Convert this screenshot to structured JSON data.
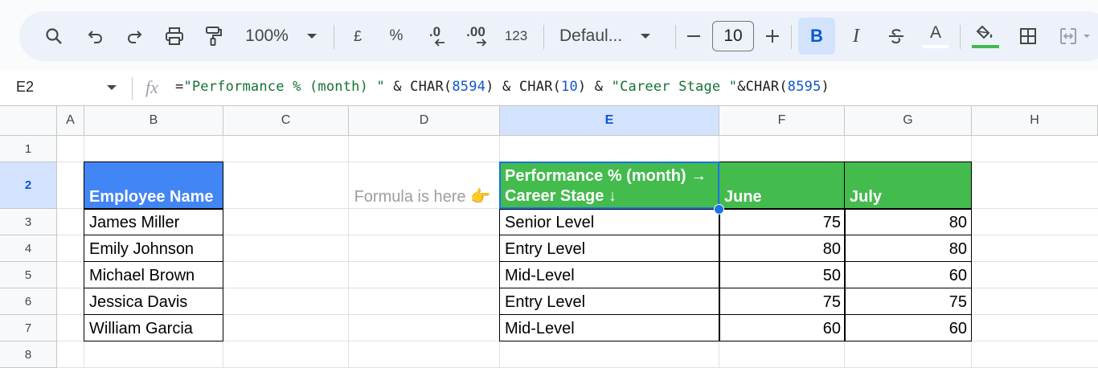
{
  "toolbar": {
    "zoom": "100%",
    "currency_label": "£",
    "percent_label": "%",
    "decrease_decimal_label": ".0",
    "increase_decimal_label": ".00",
    "more_formats_label": "123",
    "font_name": "Defaul...",
    "font_size": "10",
    "bold_label": "B",
    "italic_label": "I",
    "text_color_label": "A"
  },
  "formula_bar": {
    "name_box": "E2",
    "fx_label": "fx",
    "formula_parts": {
      "p1": "=",
      "p2": "\"Performance % (month) \"",
      "p3": " & CHAR(",
      "p4": "8594",
      "p5": ") & CHAR(",
      "p6": "10",
      "p7": ") & ",
      "p8": "\"Career Stage \"",
      "p9": "&CHAR(",
      "p10": "8595",
      "p11": ")"
    }
  },
  "columns": [
    "A",
    "B",
    "C",
    "D",
    "E",
    "F",
    "G",
    "H"
  ],
  "rows": [
    "1",
    "2",
    "3",
    "4",
    "5",
    "6",
    "7",
    "8"
  ],
  "sheet": {
    "b2": "Employee Name",
    "d2": "Formula is here 👉",
    "e2": "Performance % (month) →\nCareer Stage ↓",
    "f2": "June",
    "g2": "July",
    "employees": [
      "James Miller",
      "Emily Johnson",
      "Michael Brown",
      "Jessica Davis",
      "William Garcia"
    ],
    "stages": [
      "Senior Level",
      "Entry Level",
      "Mid-Level",
      "Entry Level",
      "Mid-Level"
    ],
    "june": [
      "75",
      "80",
      "50",
      "75",
      "60"
    ],
    "july": [
      "80",
      "80",
      "60",
      "75",
      "60"
    ]
  },
  "colors": {
    "header_blue": "#4285f4",
    "header_green": "#43bb4d",
    "selection": "#1a73e8"
  }
}
